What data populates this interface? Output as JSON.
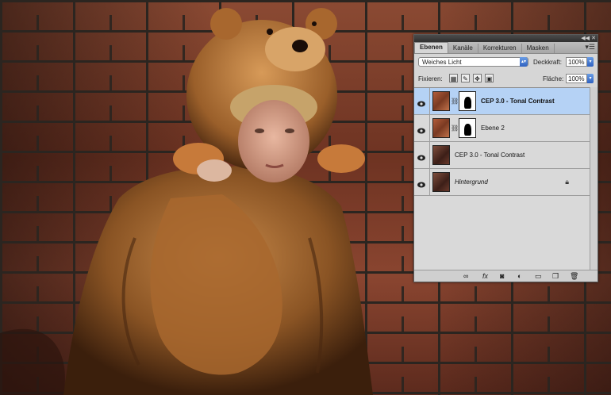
{
  "panel": {
    "tabs": [
      {
        "label": "Ebenen"
      },
      {
        "label": "Kanäle"
      },
      {
        "label": "Korrekturen"
      },
      {
        "label": "Masken"
      }
    ],
    "blend_mode": "Weiches Licht",
    "opacity_label": "Deckkraft:",
    "opacity_value": "100%",
    "lock_label": "Fixieren:",
    "fill_label": "Fläche:",
    "fill_value": "100%",
    "layers": [
      {
        "name": "CEP 3.0 - Tonal Contrast",
        "selected": true,
        "has_mask": true
      },
      {
        "name": "Ebene 2",
        "selected": false,
        "has_mask": true
      },
      {
        "name": "CEP 3.0 - Tonal Contrast",
        "selected": false,
        "has_mask": false
      },
      {
        "name": "Hintergrund",
        "selected": false,
        "has_mask": false,
        "locked": true
      }
    ]
  },
  "colors": {
    "selection": "#b5d2f5",
    "panel_bg": "#d6d6d6",
    "accent_blue": "#3f74d4"
  }
}
